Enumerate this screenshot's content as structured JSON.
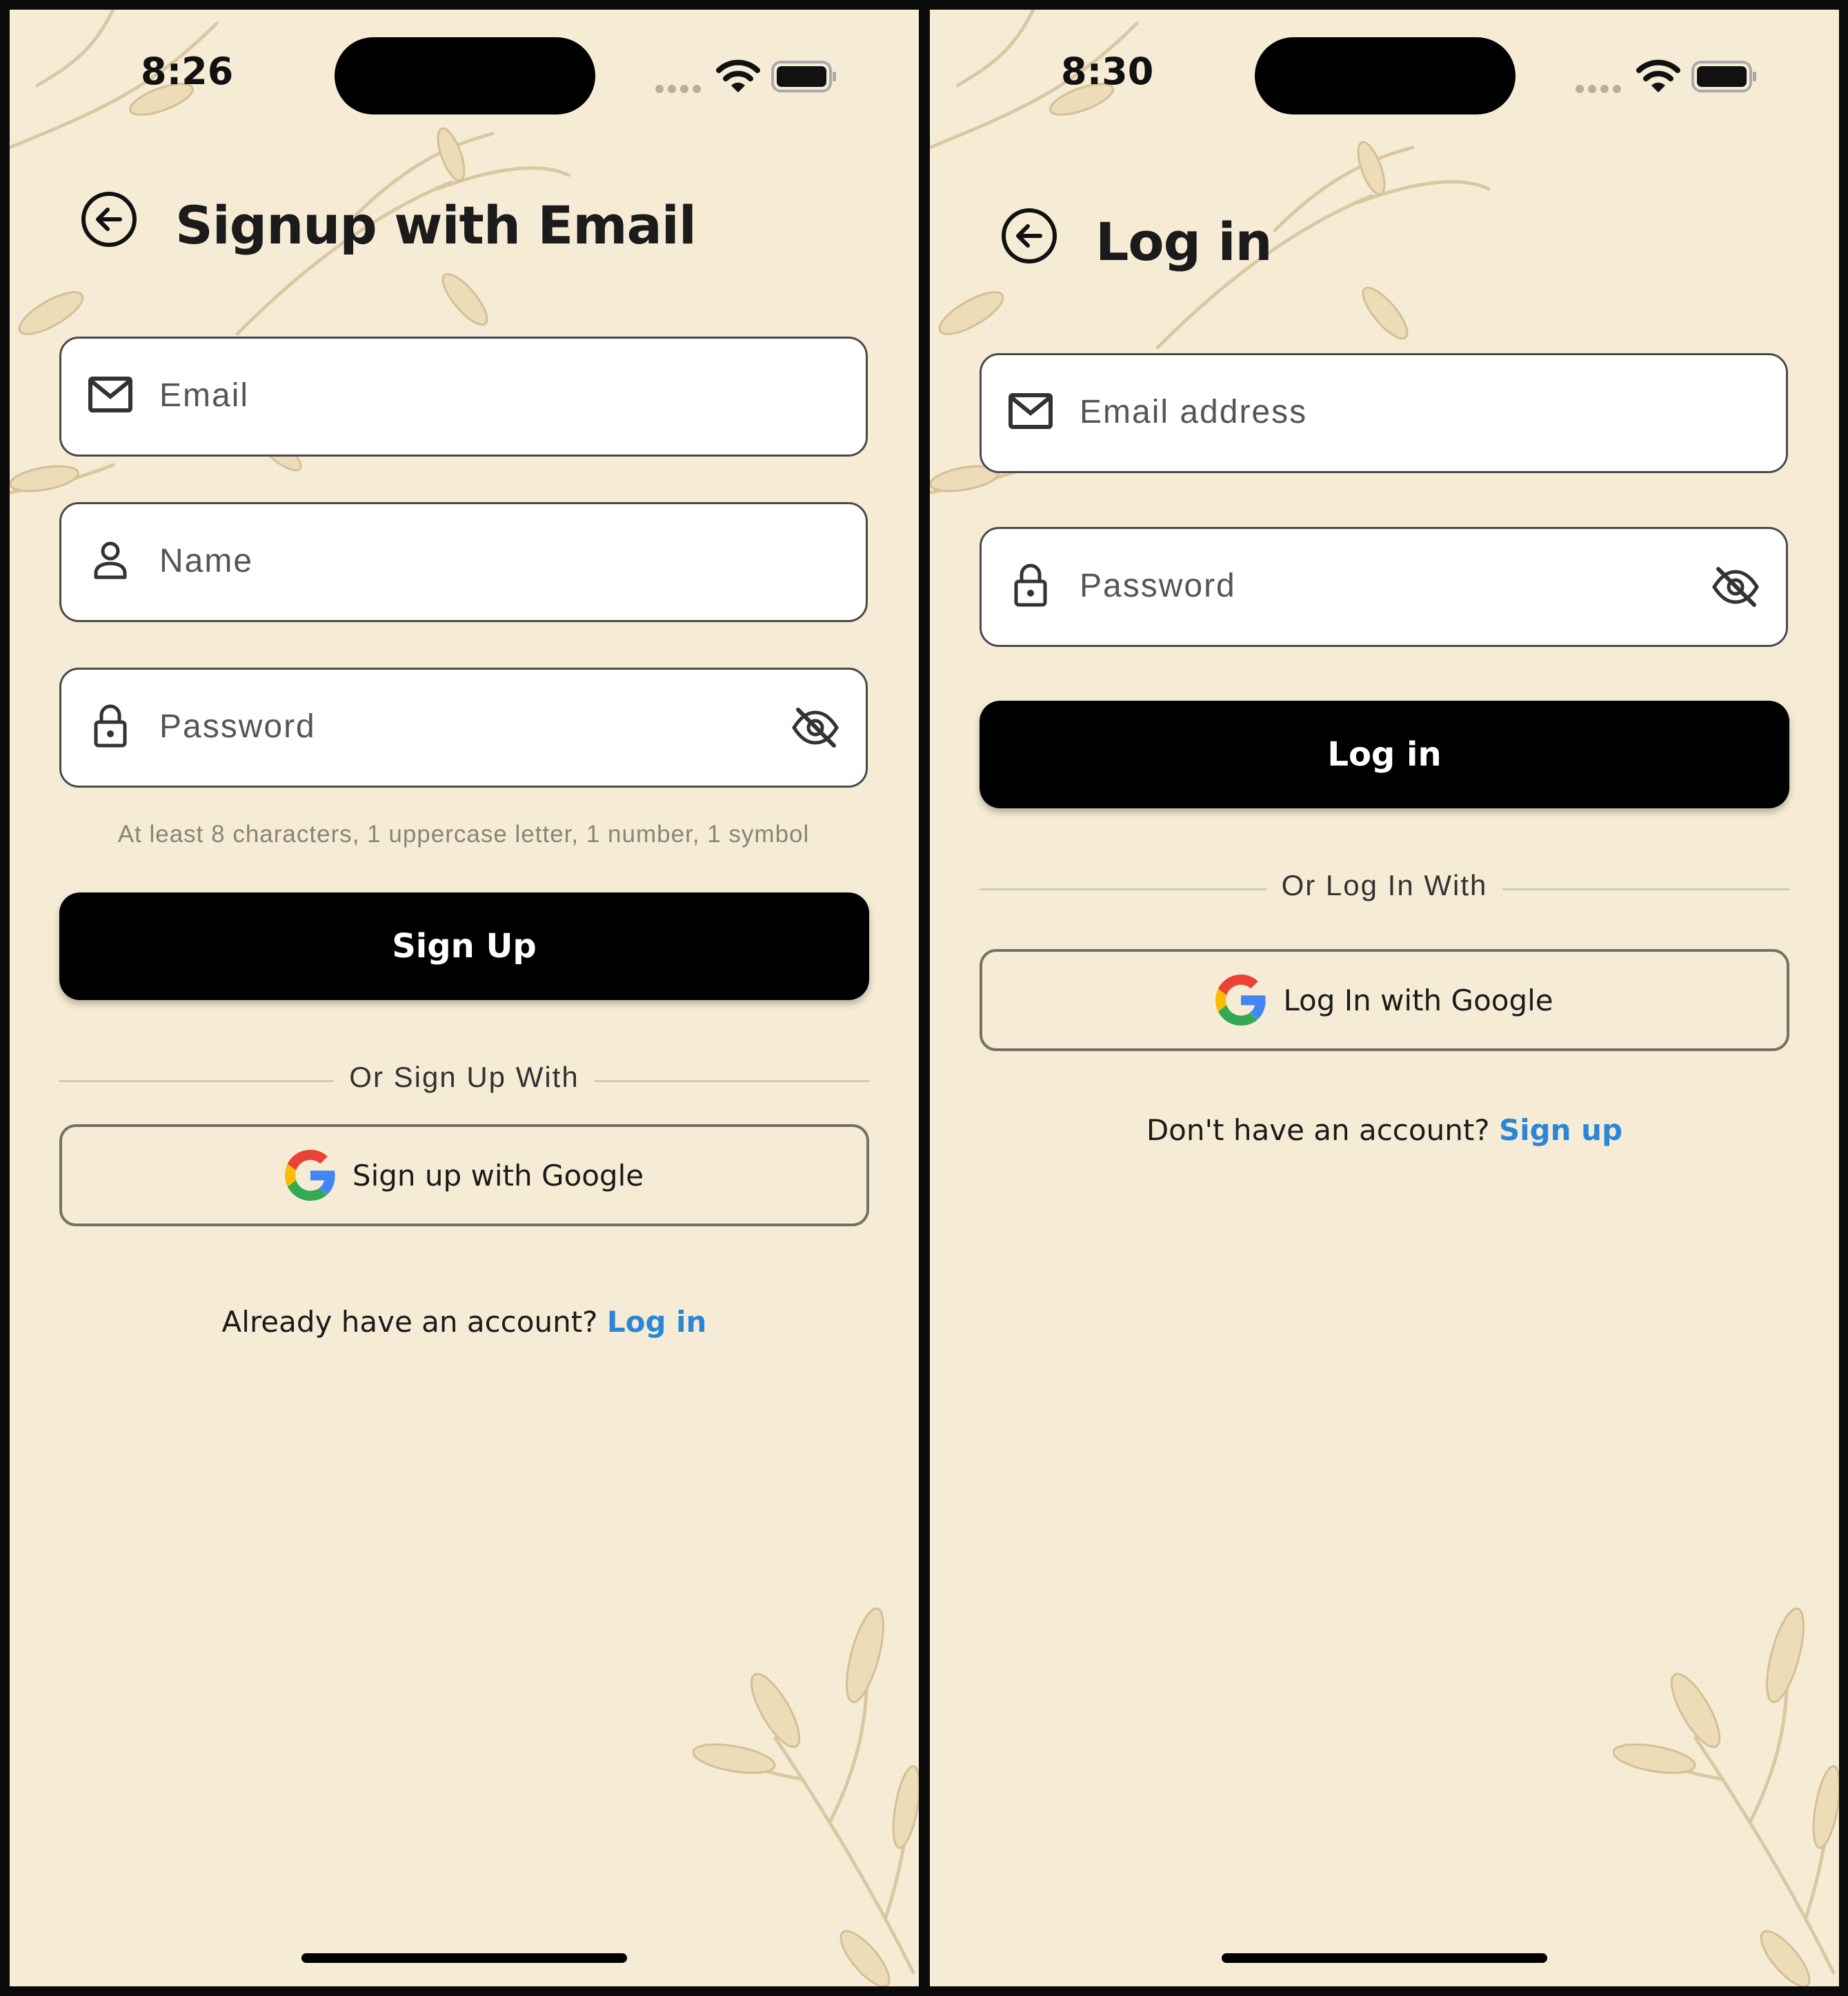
{
  "signup_screen": {
    "status_time": "8:26",
    "title": "Signup with Email",
    "fields": {
      "email_placeholder": "Email",
      "name_placeholder": "Name",
      "password_placeholder": "Password"
    },
    "password_hint": "At least 8 characters, 1 uppercase letter, 1 number, 1 symbol",
    "submit_label": "Sign Up",
    "divider_text": "Or Sign Up With",
    "google_label": "Sign up with Google",
    "footer_text": "Already have an account?",
    "footer_link": "Log in"
  },
  "login_screen": {
    "status_time": "8:30",
    "title": "Log in",
    "fields": {
      "email_placeholder": "Email address",
      "password_placeholder": "Password"
    },
    "submit_label": "Log in",
    "divider_text": "Or Log In With",
    "google_label": "Log In with Google",
    "footer_text": "Don't have an account?",
    "footer_link": "Sign up"
  },
  "icons": {
    "back": "back-arrow-circle-icon",
    "email": "mail-icon",
    "name": "person-icon",
    "password": "lock-icon",
    "visibility": "eye-off-icon",
    "google": "google-logo-icon",
    "wifi": "wifi-icon",
    "battery": "battery-icon"
  },
  "colors": {
    "background": "#f6ecd6",
    "primary_button": "#000000",
    "link": "#2b86d8",
    "field_border": "#4a4a4a"
  }
}
